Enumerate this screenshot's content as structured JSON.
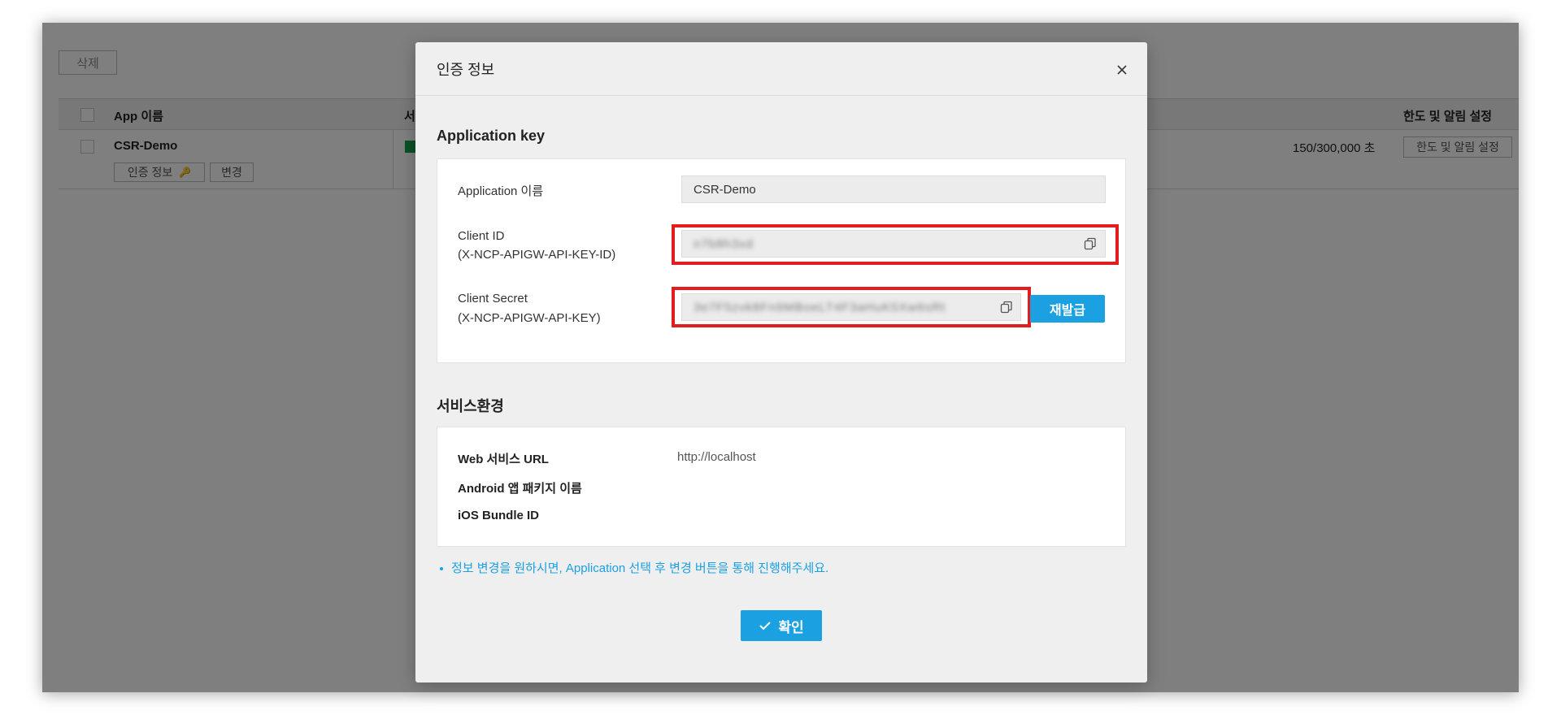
{
  "background": {
    "delete_label": "삭제",
    "columns": {
      "app_name": "App 이름",
      "service": "서",
      "limit": "한도 및 알림 설정"
    },
    "row": {
      "app_name": "CSR-Demo",
      "auth_info_label": "인증 정보",
      "change_label": "변경",
      "usage": "150/300,000 초",
      "limit_button": "한도 및 알림 설정"
    }
  },
  "modal": {
    "title": "인증 정보",
    "app_key_section": "Application key",
    "app_name_label": "Application 이름",
    "app_name_value": "CSR-Demo",
    "client_id_label": "Client ID",
    "client_id_header": "(X-NCP-APIGW-API-KEY-ID)",
    "client_id_value": "n7b8h3xd",
    "client_secret_label": "Client Secret",
    "client_secret_header": "(X-NCP-APIGW-API-KEY)",
    "client_secret_value": "3e7F5zvk8Fn9MBoeLT4F3aHuK5Xw6sRt",
    "reissue_label": "재발급",
    "service_env_section": "서비스환경",
    "web_url_label": "Web 서비스 URL",
    "web_url_value": "http://localhost",
    "android_label": "Android 앱 패키지 이름",
    "ios_label": "iOS Bundle ID",
    "note": "정보 변경을 원하시면, Application 선택 후 변경 버튼을 통해 진행해주세요.",
    "confirm_label": "확인"
  },
  "colors": {
    "accent": "#1ba0e2",
    "highlight": "#e21d1d"
  }
}
